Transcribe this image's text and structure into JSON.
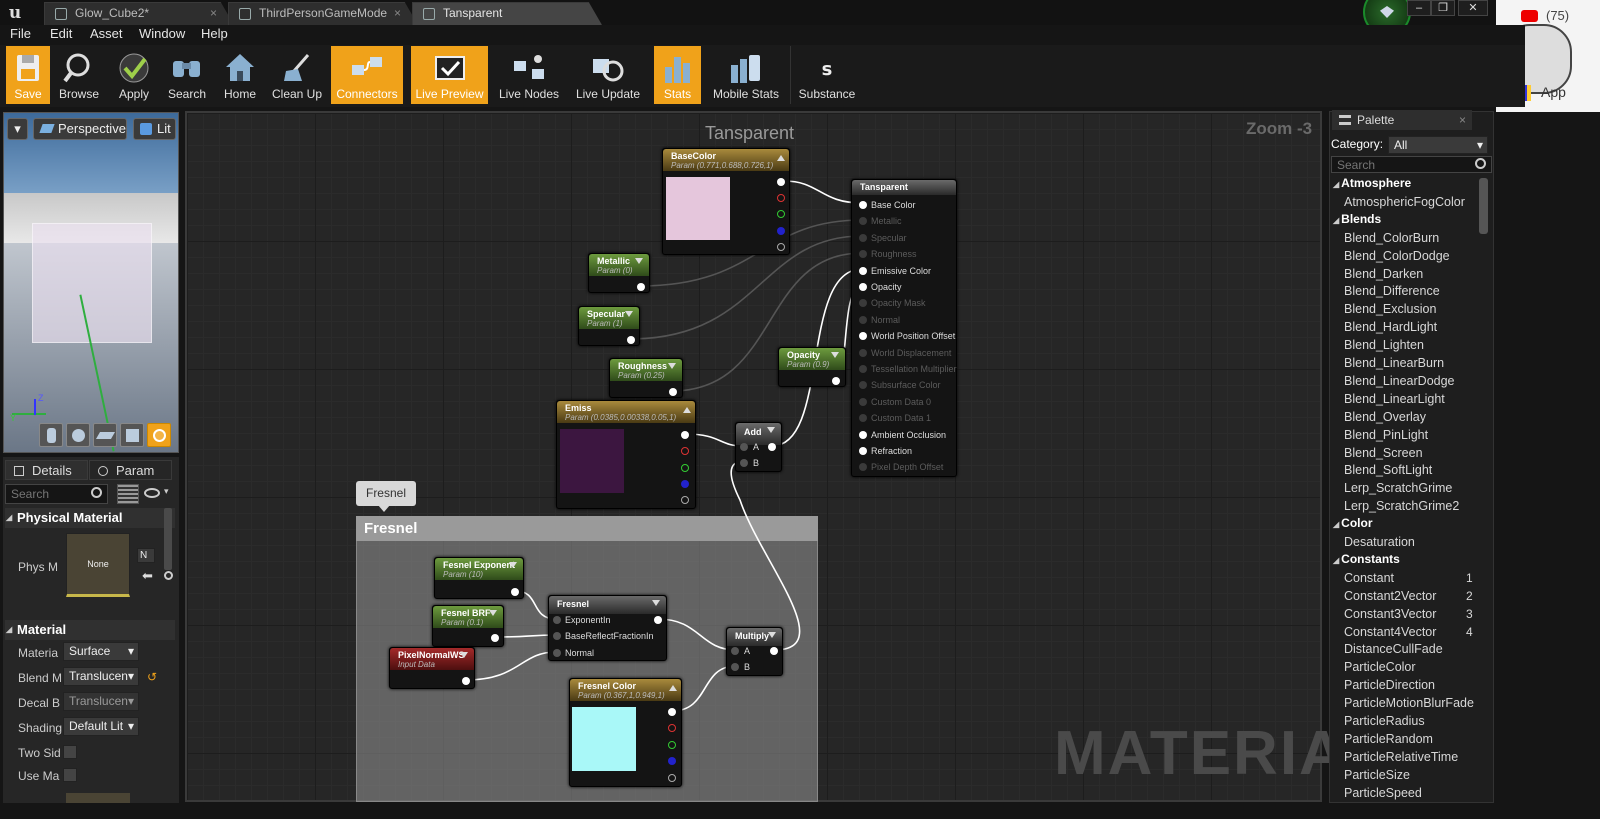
{
  "tabs": [
    {
      "label": "Glow_Cube2*"
    },
    {
      "label": "ThirdPersonGameMode"
    },
    {
      "label": "Tansparent"
    }
  ],
  "menu": [
    "File",
    "Edit",
    "Asset",
    "Window",
    "Help"
  ],
  "toolbar": [
    {
      "label": "Save",
      "icon": "save-icon"
    },
    {
      "label": "Browse",
      "icon": "browse-icon"
    },
    {
      "label": "Apply",
      "icon": "apply-icon"
    },
    {
      "label": "Search",
      "icon": "search-icon"
    },
    {
      "label": "Home",
      "icon": "home-icon"
    },
    {
      "label": "Clean Up",
      "icon": "clean-up-icon"
    },
    {
      "label": "Connectors",
      "icon": "connectors-icon"
    },
    {
      "label": "Live Preview",
      "icon": "live-preview-icon"
    },
    {
      "label": "Live Nodes",
      "icon": "live-nodes-icon"
    },
    {
      "label": "Live Update",
      "icon": "live-update-icon"
    },
    {
      "label": "Stats",
      "icon": "stats-icon"
    },
    {
      "label": "Mobile Stats",
      "icon": "mobile-stats-icon"
    },
    {
      "label": "Substance",
      "icon": "substance-icon"
    }
  ],
  "external": {
    "counter": "(75)",
    "apps_label": "App"
  },
  "viewport": {
    "perspective": "Perspective",
    "lit": "Lit",
    "axis_z": "Z",
    "axis_y": "Y"
  },
  "details": {
    "tab_details": "Details",
    "tab_param": "Param",
    "search_placeholder": "Search",
    "physical_material_header": "Physical Material",
    "phys_m_label": "Phys M",
    "phys_m_value": "None",
    "phys_m_extra": "N",
    "material_header": "Material",
    "props": [
      {
        "label": "Materia",
        "value": "Surface"
      },
      {
        "label": "Blend M",
        "value": "Translucen"
      },
      {
        "label": "Decal B",
        "value": "Translucen"
      },
      {
        "label": "Shading",
        "value": "Default Lit"
      },
      {
        "label": "Two Sid"
      },
      {
        "label": "Use Ma"
      }
    ]
  },
  "graph": {
    "title": "Tansparent",
    "zoom": "Zoom -3",
    "watermark": "MATERIAL",
    "comment_bubble": "Fresnel",
    "comment_title": "Fresnel"
  },
  "nodes": {
    "basecolor": {
      "title": "BaseColor",
      "sub": "Param (0.771,0.688,0.726,1)",
      "color": "#e5c6dc"
    },
    "metallic": {
      "title": "Metallic",
      "sub": "Param (0)"
    },
    "specular": {
      "title": "Specular",
      "sub": "Param (1)"
    },
    "roughness": {
      "title": "Roughness",
      "sub": "Param (0.25)"
    },
    "emiss": {
      "title": "Emiss",
      "sub": "Param (0.0385,0.00338,0.05,1)",
      "color": "#3c1640"
    },
    "opacity": {
      "title": "Opacity",
      "sub": "Param (0.9)"
    },
    "add": {
      "title": "Add",
      "a": "A",
      "b": "B"
    },
    "fexp": {
      "title": "Fesnel Exponent",
      "sub": "Param (10)"
    },
    "fbrf": {
      "title": "Fesnel BRF",
      "sub": "Param (0.1)"
    },
    "pnws": {
      "title": "PixelNormalWS",
      "sub": "Input Data"
    },
    "fresnel": {
      "title": "Fresnel",
      "in1": "ExponentIn",
      "in2": "BaseReflectFractionIn",
      "in3": "Normal"
    },
    "multiply": {
      "title": "Multiply",
      "a": "A",
      "b": "B"
    },
    "fcolor": {
      "title": "Fresnel Color",
      "sub": "Param (0.367,1,0.949,1)",
      "color": "#a9f8f8"
    },
    "result": {
      "title": "Tansparent",
      "pins": [
        {
          "label": "Base Color",
          "active": true
        },
        {
          "label": "Metallic",
          "active": false
        },
        {
          "label": "Specular",
          "active": false
        },
        {
          "label": "Roughness",
          "active": false
        },
        {
          "label": "Emissive Color",
          "active": true
        },
        {
          "label": "Opacity",
          "active": true
        },
        {
          "label": "Opacity Mask",
          "active": false
        },
        {
          "label": "Normal",
          "active": false
        },
        {
          "label": "World Position Offset",
          "active": true
        },
        {
          "label": "World Displacement",
          "active": false
        },
        {
          "label": "Tessellation Multiplier",
          "active": false
        },
        {
          "label": "Subsurface Color",
          "active": false
        },
        {
          "label": "Custom Data 0",
          "active": false
        },
        {
          "label": "Custom Data 1",
          "active": false
        },
        {
          "label": "Ambient Occlusion",
          "active": true
        },
        {
          "label": "Refraction",
          "active": true
        },
        {
          "label": "Pixel Depth Offset",
          "active": false
        }
      ]
    }
  },
  "palette": {
    "tab": "Palette",
    "category_label": "Category:",
    "category_value": "All",
    "search_placeholder": "Search",
    "groups": [
      {
        "name": "Atmosphere",
        "items": [
          {
            "label": "AtmosphericFogColor"
          }
        ]
      },
      {
        "name": "Blends",
        "items": [
          {
            "label": "Blend_ColorBurn"
          },
          {
            "label": "Blend_ColorDodge"
          },
          {
            "label": "Blend_Darken"
          },
          {
            "label": "Blend_Difference"
          },
          {
            "label": "Blend_Exclusion"
          },
          {
            "label": "Blend_HardLight"
          },
          {
            "label": "Blend_Lighten"
          },
          {
            "label": "Blend_LinearBurn"
          },
          {
            "label": "Blend_LinearDodge"
          },
          {
            "label": "Blend_LinearLight"
          },
          {
            "label": "Blend_Overlay"
          },
          {
            "label": "Blend_PinLight"
          },
          {
            "label": "Blend_Screen"
          },
          {
            "label": "Blend_SoftLight"
          },
          {
            "label": "Lerp_ScratchGrime"
          },
          {
            "label": "Lerp_ScratchGrime2"
          }
        ]
      },
      {
        "name": "Color",
        "items": [
          {
            "label": "Desaturation"
          }
        ]
      },
      {
        "name": "Constants",
        "items": [
          {
            "label": "Constant",
            "hotkey": "1"
          },
          {
            "label": "Constant2Vector",
            "hotkey": "2"
          },
          {
            "label": "Constant3Vector",
            "hotkey": "3"
          },
          {
            "label": "Constant4Vector",
            "hotkey": "4"
          },
          {
            "label": "DistanceCullFade"
          },
          {
            "label": "ParticleColor"
          },
          {
            "label": "ParticleDirection"
          },
          {
            "label": "ParticleMotionBlurFade"
          },
          {
            "label": "ParticleRadius"
          },
          {
            "label": "ParticleRandom"
          },
          {
            "label": "ParticleRelativeTime"
          },
          {
            "label": "ParticleSize"
          },
          {
            "label": "ParticleSpeed"
          }
        ]
      }
    ]
  },
  "colors": {
    "accent": "#f0a21a",
    "graph_bg": "#262626",
    "param_green": "#5a8a30",
    "vector_gold": "#9a7a2a",
    "input_red": "#9b2020"
  }
}
